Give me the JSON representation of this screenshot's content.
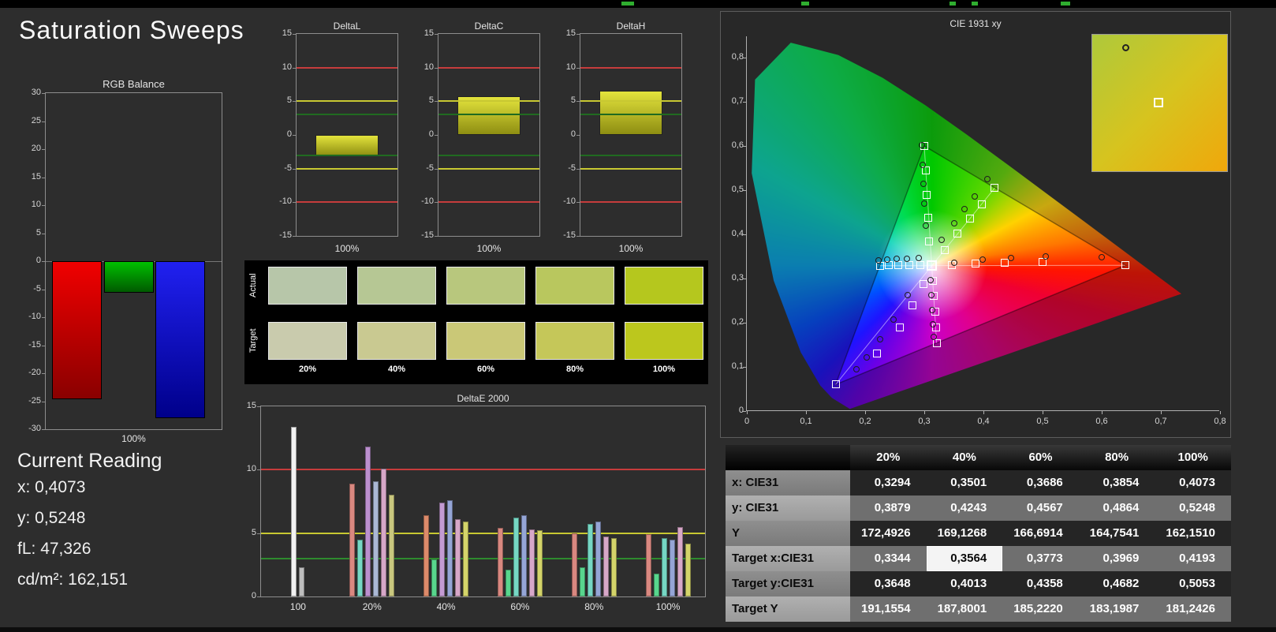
{
  "app": {
    "title": "Saturation Sweeps"
  },
  "current_reading": {
    "title": "Current Reading",
    "items": [
      {
        "key": "x",
        "label": "x:",
        "value": "0,4073"
      },
      {
        "key": "y",
        "label": "y:",
        "value": "0,5248"
      },
      {
        "key": "fl",
        "label": "fL:",
        "value": "47,326"
      },
      {
        "key": "cdm2",
        "label": "cd/m²:",
        "value": "162,151"
      }
    ]
  },
  "swatch_panel": {
    "row_labels": [
      "Actual",
      "Target"
    ],
    "col_labels": [
      "20%",
      "40%",
      "60%",
      "80%",
      "100%"
    ],
    "rows": [
      {
        "name": "actual",
        "colors": [
          "#b7c6a9",
          "#b6c794",
          "#b8c77d",
          "#b9c75e",
          "#b5c71e"
        ]
      },
      {
        "name": "target",
        "colors": [
          "#c9cbad",
          "#c9c991",
          "#cac877",
          "#c5c759",
          "#bcc71d"
        ]
      }
    ]
  },
  "chart_data": [
    {
      "id": "rgb_balance",
      "type": "bar",
      "title": "RGB Balance",
      "xlabel": "100%",
      "ylim": [
        -30,
        30
      ],
      "yticks": [
        30,
        25,
        20,
        15,
        10,
        5,
        0,
        -5,
        -10,
        -15,
        -20,
        -25,
        -30
      ],
      "categories": [
        "Red",
        "Green",
        "Blue"
      ],
      "values": [
        -24.6,
        -5.6,
        -28.0
      ],
      "colors": [
        "#f00000",
        "#00c000",
        "#2020f0"
      ],
      "colors_dark": [
        "#8a0000",
        "#005a00",
        "#00008a"
      ]
    },
    {
      "id": "delta_l",
      "type": "bar",
      "title": "DeltaL",
      "xlabel": "100%",
      "ylim": [
        -15,
        15
      ],
      "yticks": [
        15,
        10,
        5,
        0,
        -5,
        -10,
        -15
      ],
      "values": [
        -3.2
      ],
      "ref_lines": [
        {
          "value": 10,
          "color": "#c63c3c"
        },
        {
          "value": 5,
          "color": "#c8c832"
        },
        {
          "value": 3,
          "color": "#206a20"
        },
        {
          "value": -3,
          "color": "#206a20"
        },
        {
          "value": -5,
          "color": "#c8c832"
        },
        {
          "value": -10,
          "color": "#c63c3c"
        }
      ]
    },
    {
      "id": "delta_c",
      "type": "bar",
      "title": "DeltaC",
      "xlabel": "100%",
      "ylim": [
        -15,
        15
      ],
      "yticks": [
        15,
        10,
        5,
        0,
        -5,
        -10,
        -15
      ],
      "values": [
        5.7
      ],
      "ref_lines": [
        {
          "value": 10,
          "color": "#c63c3c"
        },
        {
          "value": 5,
          "color": "#c8c832"
        },
        {
          "value": 3,
          "color": "#206a20"
        },
        {
          "value": -3,
          "color": "#206a20"
        },
        {
          "value": -5,
          "color": "#c8c832"
        },
        {
          "value": -10,
          "color": "#c63c3c"
        }
      ]
    },
    {
      "id": "delta_h",
      "type": "bar",
      "title": "DeltaH",
      "xlabel": "100%",
      "ylim": [
        -15,
        15
      ],
      "yticks": [
        15,
        10,
        5,
        0,
        -5,
        -10,
        -15
      ],
      "values": [
        6.6
      ],
      "ref_lines": [
        {
          "value": 10,
          "color": "#c63c3c"
        },
        {
          "value": 5,
          "color": "#c8c832"
        },
        {
          "value": 3,
          "color": "#206a20"
        },
        {
          "value": -3,
          "color": "#206a20"
        },
        {
          "value": -5,
          "color": "#c8c832"
        },
        {
          "value": -10,
          "color": "#c63c3c"
        }
      ]
    },
    {
      "id": "deltae2000",
      "type": "bar",
      "title": "DeltaE 2000",
      "ylim": [
        0,
        15
      ],
      "yticks": [
        15,
        10,
        5,
        0
      ],
      "ref_lines": [
        {
          "value": 10,
          "color": "#c63c3c"
        },
        {
          "value": 5,
          "color": "#c8c832"
        },
        {
          "value": 3,
          "color": "#2e8b2e"
        }
      ],
      "groups": [
        {
          "label": "100",
          "bars": [
            {
              "color": "#f2f2f2",
              "value": 13.4
            },
            {
              "color": "#bdbdbd",
              "value": 2.3
            }
          ]
        },
        {
          "label": "20%",
          "bars": [
            {
              "color": "#d98880",
              "value": 8.9
            },
            {
              "color": "#76d7c4",
              "value": 4.5
            },
            {
              "color": "#bb8fce",
              "value": 11.8
            },
            {
              "color": "#aab7d4",
              "value": 9.1
            },
            {
              "color": "#d7a7c8",
              "value": 10.1
            },
            {
              "color": "#c9c77e",
              "value": 8.0
            }
          ]
        },
        {
          "label": "40%",
          "bars": [
            {
              "color": "#dc8a6a",
              "value": 6.4
            },
            {
              "color": "#58d68d",
              "value": 2.9
            },
            {
              "color": "#c39bd3",
              "value": 7.4
            },
            {
              "color": "#95a5d6",
              "value": 7.6
            },
            {
              "color": "#d7a7c8",
              "value": 6.1
            },
            {
              "color": "#d4d46a",
              "value": 5.9
            }
          ]
        },
        {
          "label": "60%",
          "bars": [
            {
              "color": "#d98880",
              "value": 5.4
            },
            {
              "color": "#58d68d",
              "value": 2.1
            },
            {
              "color": "#76d7c4",
              "value": 6.2
            },
            {
              "color": "#95a5d6",
              "value": 6.4
            },
            {
              "color": "#d7a7c8",
              "value": 5.3
            },
            {
              "color": "#d4d46a",
              "value": 5.2
            }
          ]
        },
        {
          "label": "80%",
          "bars": [
            {
              "color": "#d98880",
              "value": 5.0
            },
            {
              "color": "#58d68d",
              "value": 2.3
            },
            {
              "color": "#76d7c4",
              "value": 5.7
            },
            {
              "color": "#95a5d6",
              "value": 5.9
            },
            {
              "color": "#d7a7c8",
              "value": 4.7
            },
            {
              "color": "#d4d46a",
              "value": 4.6
            }
          ]
        },
        {
          "label": "100%",
          "bars": [
            {
              "color": "#d98880",
              "value": 4.9
            },
            {
              "color": "#58d68d",
              "value": 1.8
            },
            {
              "color": "#76d7c4",
              "value": 4.6
            },
            {
              "color": "#95a5d6",
              "value": 4.5
            },
            {
              "color": "#d7a7c8",
              "value": 5.5
            },
            {
              "color": "#d4d46a",
              "value": 4.2
            }
          ]
        }
      ]
    },
    {
      "id": "cie",
      "type": "scatter",
      "title": "CIE 1931 xy",
      "xlim": [
        0,
        0.8
      ],
      "ylim": [
        0,
        0.85
      ],
      "xticks": [
        "0",
        "0,1",
        "0,2",
        "0,3",
        "0,4",
        "0,5",
        "0,6",
        "0,7",
        "0,8"
      ],
      "yticks": [
        "0",
        "0,1",
        "0,2",
        "0,3",
        "0,4",
        "0,5",
        "0,6",
        "0,7",
        "0,8"
      ],
      "white_point": [
        0.3127,
        0.329
      ],
      "gamut_triangle": [
        [
          0.64,
          0.33
        ],
        [
          0.3,
          0.6
        ],
        [
          0.15,
          0.06
        ]
      ],
      "locus": [
        [
          0.1741,
          0.005
        ],
        [
          0.144,
          0.0297
        ],
        [
          0.1241,
          0.0578
        ],
        [
          0.0913,
          0.1327
        ],
        [
          0.0454,
          0.295
        ],
        [
          0.0082,
          0.5384
        ],
        [
          0.0139,
          0.7502
        ],
        [
          0.0743,
          0.8338
        ],
        [
          0.1547,
          0.8059
        ],
        [
          0.2296,
          0.7543
        ],
        [
          0.3016,
          0.6923
        ],
        [
          0.3731,
          0.6245
        ],
        [
          0.4441,
          0.5547
        ],
        [
          0.5125,
          0.4866
        ],
        [
          0.5752,
          0.4242
        ],
        [
          0.627,
          0.3725
        ],
        [
          0.6658,
          0.334
        ],
        [
          0.6915,
          0.3083
        ],
        [
          0.719,
          0.2809
        ],
        [
          0.7347,
          0.2653
        ]
      ],
      "target_squares": [
        [
          0.3468,
          0.331
        ],
        [
          0.387,
          0.3333
        ],
        [
          0.4358,
          0.336
        ],
        [
          0.5,
          0.338
        ],
        [
          0.64,
          0.33
        ],
        [
          0.3085,
          0.384
        ],
        [
          0.306,
          0.438
        ],
        [
          0.304,
          0.49
        ],
        [
          0.302,
          0.545
        ],
        [
          0.3,
          0.6
        ],
        [
          0.298,
          0.288
        ],
        [
          0.28,
          0.24
        ],
        [
          0.258,
          0.19
        ],
        [
          0.22,
          0.13
        ],
        [
          0.15,
          0.06
        ],
        [
          0.293,
          0.3295
        ],
        [
          0.274,
          0.33
        ],
        [
          0.256,
          0.33
        ],
        [
          0.24,
          0.3295
        ],
        [
          0.225,
          0.329
        ],
        [
          0.314,
          0.295
        ],
        [
          0.316,
          0.26
        ],
        [
          0.318,
          0.225
        ],
        [
          0.3195,
          0.19
        ],
        [
          0.3209,
          0.154
        ],
        [
          0.3344,
          0.3648
        ],
        [
          0.3564,
          0.4013
        ],
        [
          0.3773,
          0.4358
        ],
        [
          0.3969,
          0.4682
        ],
        [
          0.4193,
          0.5053
        ]
      ],
      "measured_circles": [
        [
          0.35,
          0.336
        ],
        [
          0.398,
          0.342
        ],
        [
          0.447,
          0.347
        ],
        [
          0.505,
          0.35
        ],
        [
          0.6,
          0.349
        ],
        [
          0.303,
          0.42
        ],
        [
          0.3,
          0.47
        ],
        [
          0.298,
          0.515
        ],
        [
          0.297,
          0.558
        ],
        [
          0.296,
          0.602
        ],
        [
          0.272,
          0.263
        ],
        [
          0.248,
          0.208
        ],
        [
          0.225,
          0.162
        ],
        [
          0.203,
          0.122
        ],
        [
          0.185,
          0.095
        ],
        [
          0.29,
          0.347
        ],
        [
          0.271,
          0.345
        ],
        [
          0.253,
          0.344
        ],
        [
          0.237,
          0.342
        ],
        [
          0.223,
          0.341
        ],
        [
          0.311,
          0.297
        ],
        [
          0.312,
          0.263
        ],
        [
          0.313,
          0.228
        ],
        [
          0.314,
          0.196
        ],
        [
          0.316,
          0.168
        ],
        [
          0.3294,
          0.3879
        ],
        [
          0.3501,
          0.4243
        ],
        [
          0.3686,
          0.4567
        ],
        [
          0.3854,
          0.4864
        ],
        [
          0.4073,
          0.5248
        ]
      ]
    },
    {
      "id": "results_table",
      "type": "table",
      "columns": [
        "",
        "20%",
        "40%",
        "60%",
        "80%",
        "100%"
      ],
      "rows": [
        {
          "label": "x: CIE31",
          "values": [
            "0,3294",
            "0,3501",
            "0,3686",
            "0,3854",
            "0,4073"
          ]
        },
        {
          "label": "y: CIE31",
          "values": [
            "0,3879",
            "0,4243",
            "0,4567",
            "0,4864",
            "0,5248"
          ]
        },
        {
          "label": "Y",
          "values": [
            "172,4926",
            "169,1268",
            "166,6914",
            "164,7541",
            "162,1510"
          ]
        },
        {
          "label": "Target x:CIE31",
          "values": [
            "0,3344",
            "0,3564",
            "0,3773",
            "0,3969",
            "0,4193"
          ]
        },
        {
          "label": "Target y:CIE31",
          "values": [
            "0,3648",
            "0,4013",
            "0,4358",
            "0,4682",
            "0,5053"
          ]
        },
        {
          "label": "Target Y",
          "values": [
            "191,1554",
            "187,8001",
            "185,2220",
            "183,1987",
            "181,2426"
          ]
        }
      ],
      "highlight": {
        "row": 3,
        "col": 1
      }
    }
  ]
}
